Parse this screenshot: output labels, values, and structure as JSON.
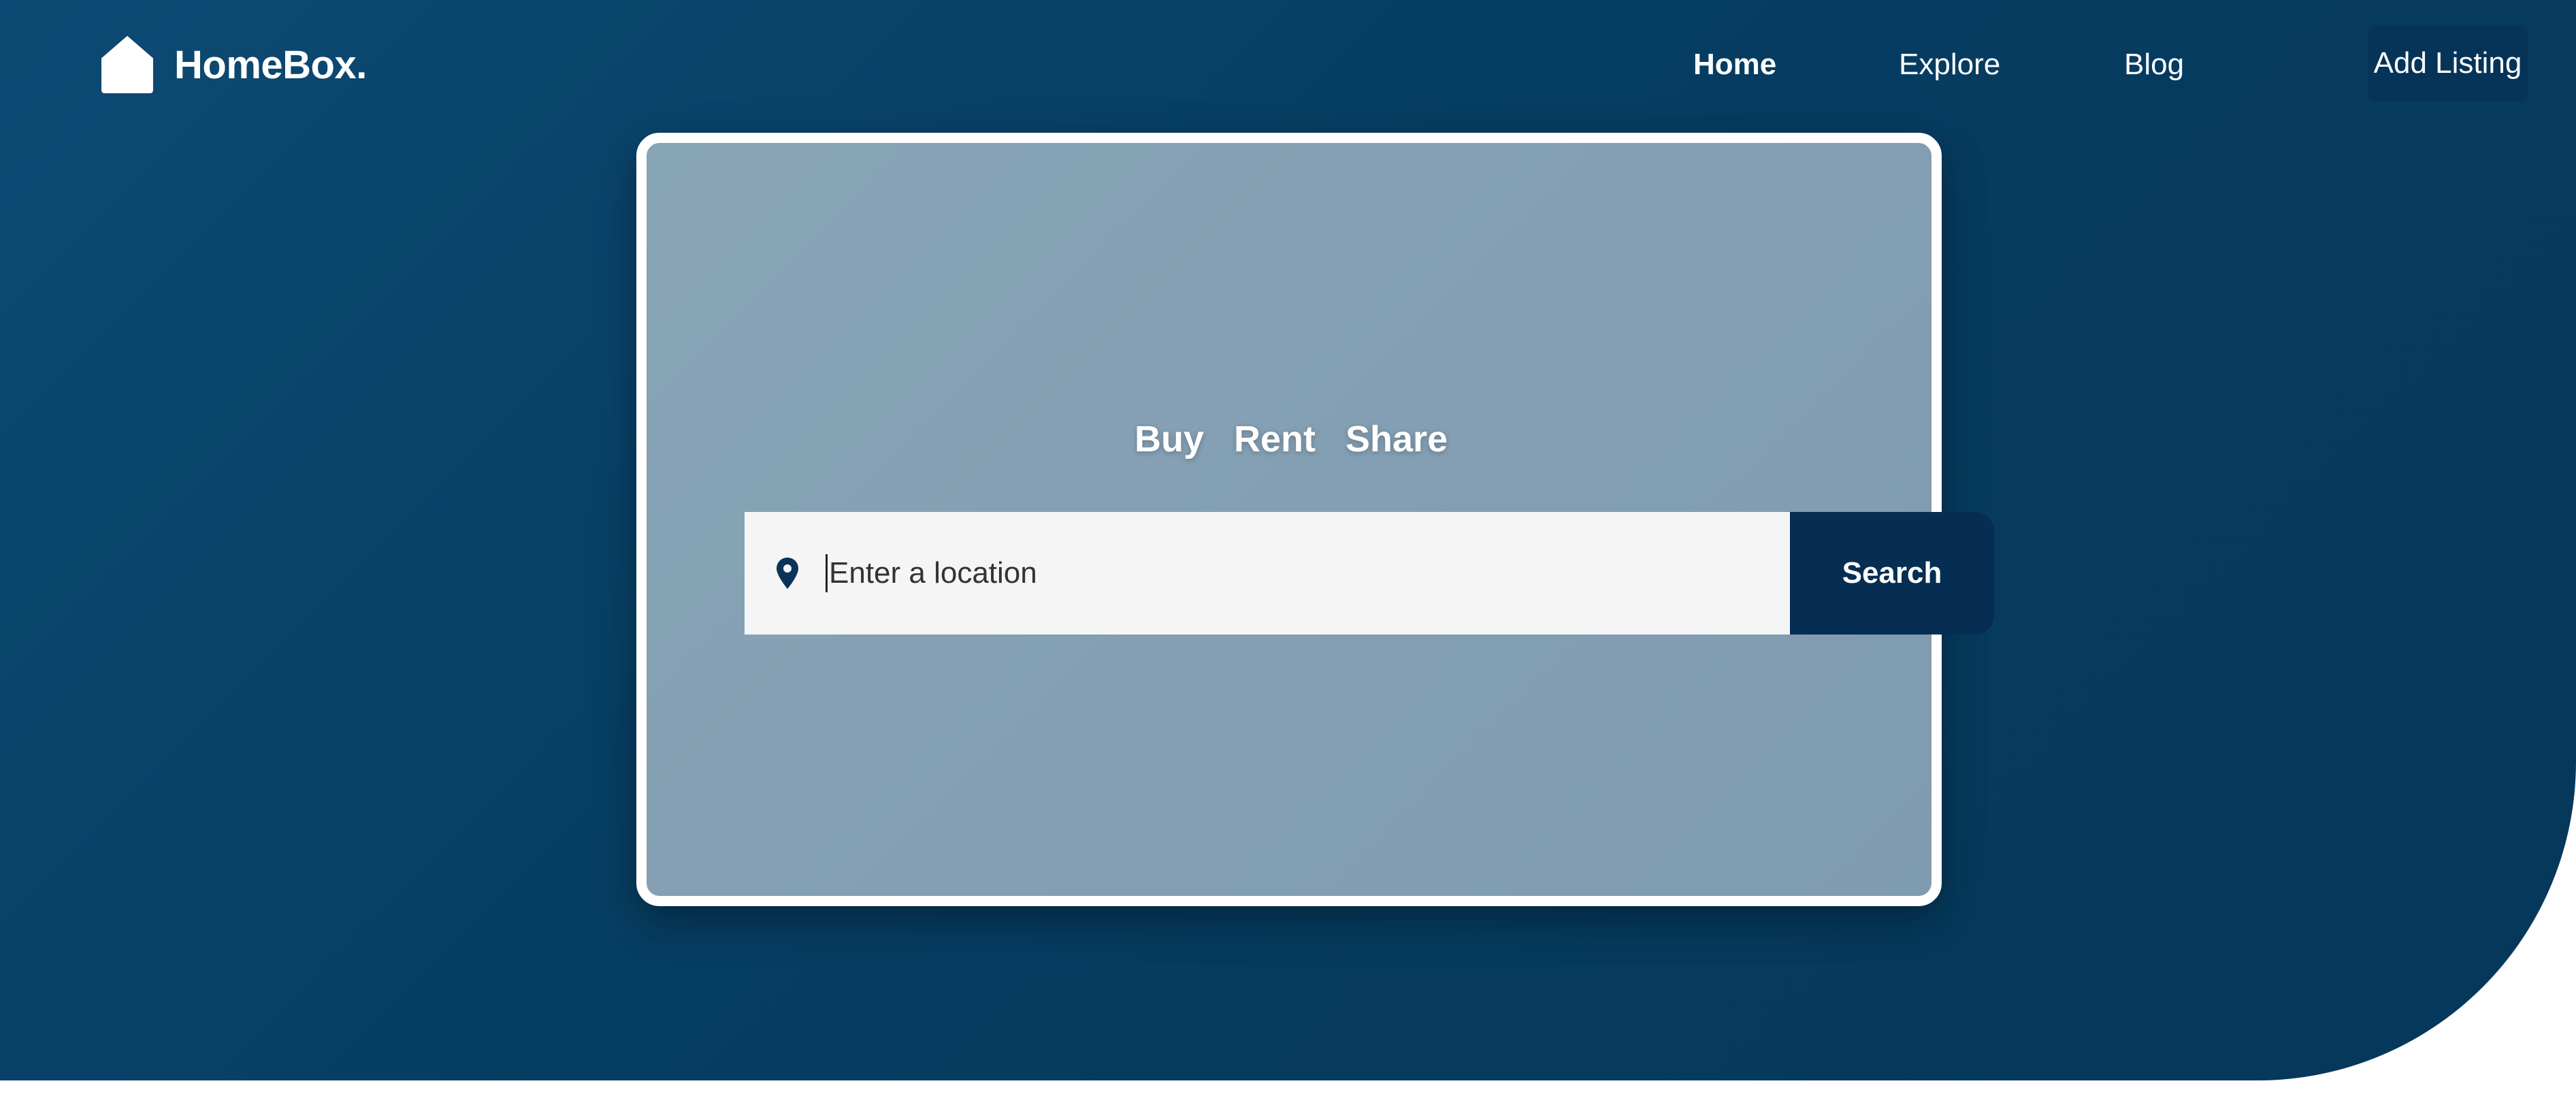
{
  "brand": {
    "name": "HomeBox.",
    "logo_icon": "house-icon"
  },
  "nav": {
    "home": "Home",
    "explore": "Explore",
    "blog": "Blog",
    "add_listing": "Add Listing"
  },
  "hero": {
    "tabs": [
      "Buy",
      "Rent",
      "Share"
    ],
    "search": {
      "placeholder": "Enter a location",
      "value": "",
      "icon": "location-pin-icon",
      "button_label": "Search"
    }
  },
  "colors": {
    "hero_background": "#0b4870",
    "card_background": "#849fb3",
    "button_dark": "#052e52",
    "input_background": "#f5f5f5",
    "text_light": "#ffffff"
  }
}
